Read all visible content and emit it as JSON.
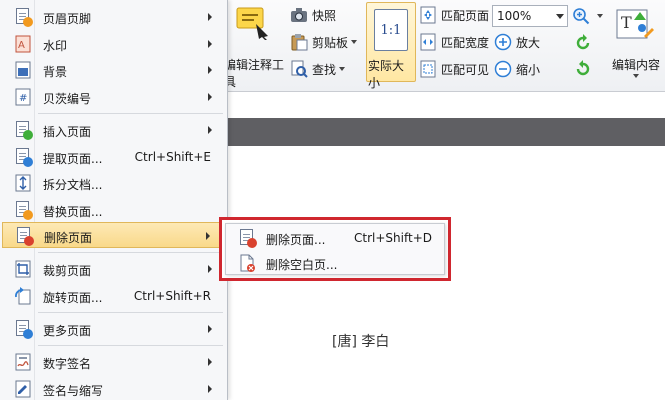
{
  "ribbon": {
    "annotation_tools_label": "编辑注释工具",
    "snapshot_label": "快照",
    "clipboard_label": "剪贴板",
    "find_label": "查找",
    "actual_size_label": "实际大小",
    "actual_size_icon_text": "1:1",
    "fit_page_label": "匹配页面",
    "fit_width_label": "匹配宽度",
    "fit_visible_label": "匹配可见",
    "zoom_value": "100%",
    "zoom_in_label": "放大",
    "zoom_out_label": "缩小",
    "edit_content_label": "编辑内容"
  },
  "menu": {
    "items": [
      {
        "label": "页眉页脚",
        "shortcut": "",
        "submenu": true
      },
      {
        "label": "水印",
        "shortcut": "",
        "submenu": true
      },
      {
        "label": "背景",
        "shortcut": "",
        "submenu": true
      },
      {
        "label": "贝茨编号",
        "shortcut": "",
        "submenu": true
      },
      {
        "label": "插入页面",
        "shortcut": "",
        "submenu": true
      },
      {
        "label": "提取页面...",
        "shortcut": "Ctrl+Shift+E",
        "submenu": false
      },
      {
        "label": "拆分文档...",
        "shortcut": "",
        "submenu": false
      },
      {
        "label": "替换页面...",
        "shortcut": "",
        "submenu": false
      },
      {
        "label": "删除页面",
        "shortcut": "",
        "submenu": true
      },
      {
        "label": "裁剪页面",
        "shortcut": "",
        "submenu": true
      },
      {
        "label": "旋转页面...",
        "shortcut": "Ctrl+Shift+R",
        "submenu": false
      },
      {
        "label": "更多页面",
        "shortcut": "",
        "submenu": true
      },
      {
        "label": "数字签名",
        "shortcut": "",
        "submenu": true
      },
      {
        "label": "签名与缩写",
        "shortcut": "",
        "submenu": true
      }
    ]
  },
  "submenu": {
    "items": [
      {
        "label": "删除页面...",
        "shortcut": "Ctrl+Shift+D"
      },
      {
        "label": "删除空白页..."
      }
    ]
  },
  "document": {
    "author_line": "[唐] 李白"
  },
  "colors": {
    "highlight_border": "#d0272f",
    "active_item_bg": "#f9d98a",
    "doc_strip": "#5f5f63"
  }
}
